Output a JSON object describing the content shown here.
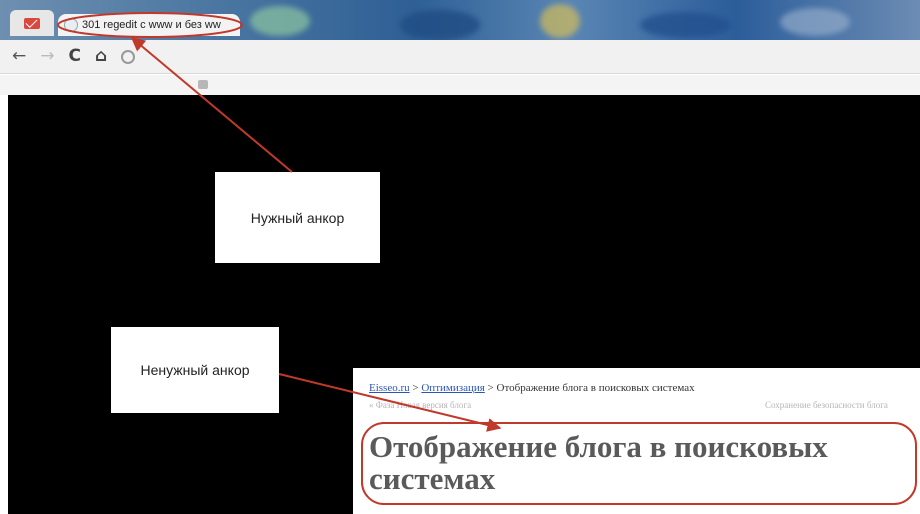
{
  "browser": {
    "active_tab_title": "301 regedit с www и без ww",
    "nav_icons": {
      "back": "←",
      "forward": "→",
      "reload": "C",
      "home": "⌂"
    }
  },
  "callouts": {
    "needed_anchor": "Нужный анкор",
    "unneeded_anchor": "Ненужный анкор"
  },
  "snippet": {
    "breadcrumb_site": "Eisseo.ru",
    "breadcrumb_sep1": " > ",
    "breadcrumb_section": "Оптимизация",
    "breadcrumb_sep2": " > ",
    "breadcrumb_page": "Отображение блога в поисковых системах",
    "prev_link": "«  Фаза Новая версия блога",
    "next_link": "Сохранение безопасности блога",
    "heading": "Отображение блога в поисковых системах"
  },
  "annotation_color": "#c0392b"
}
